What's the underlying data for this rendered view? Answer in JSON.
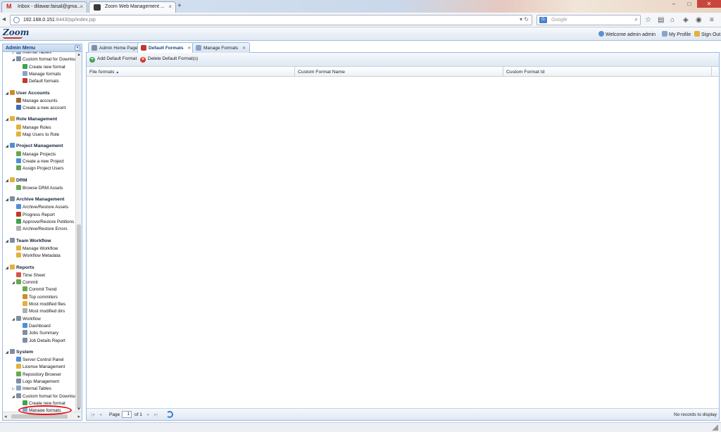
{
  "browser": {
    "tabs": [
      {
        "title": "Inbox - dilawar.faisal@gma...",
        "icon": "gmail-icon"
      },
      {
        "title": "Zoom Web Management ...",
        "icon": "zoom-page-icon"
      }
    ],
    "new_tab": "+",
    "address": {
      "host": "192.168.0.151",
      "rest": ":8443/jsp/index.jsp"
    },
    "search": {
      "engine": "G",
      "placeholder": "Google"
    },
    "window_buttons": {
      "minimize": "–",
      "maximize": "□",
      "close": "✕"
    }
  },
  "app": {
    "logo": "Zoom",
    "header_links": {
      "welcome": "Welcome admin admin",
      "profile": "My Profile",
      "signout": "Sign Out"
    }
  },
  "sidebar": {
    "title": "Admin Menu",
    "collapse": "«",
    "tree": [
      {
        "label": "Internal Tables",
        "level": 1,
        "icon": "table-icon",
        "color": "#8aa4c8"
      },
      {
        "label": "Custom format for Downloa",
        "level": 1,
        "icon": "format-icon",
        "color": "#7f8ea3",
        "expanded": true
      },
      {
        "label": "Create new format",
        "level": 2,
        "icon": "add-icon",
        "color": "#3fa34d"
      },
      {
        "label": "Manage formats",
        "level": 2,
        "icon": "list-icon",
        "color": "#8aa4c8"
      },
      {
        "label": "Default formats",
        "level": 2,
        "icon": "default-format-icon",
        "color": "#c0392b"
      },
      {
        "label": "User Accounts",
        "level": 0,
        "icon": "users-icon",
        "color": "#d18b2c",
        "group": true
      },
      {
        "label": "Manage accounts",
        "level": 1,
        "icon": "account-icon",
        "color": "#a0693a"
      },
      {
        "label": "Create a new account",
        "level": 1,
        "icon": "new-account-icon",
        "color": "#3b6fb5"
      },
      {
        "label": "Role Management",
        "level": 0,
        "icon": "role-icon",
        "color": "#e3b23c",
        "group": true
      },
      {
        "label": "Manage Roles",
        "level": 1,
        "icon": "roles-icon",
        "color": "#e3b23c"
      },
      {
        "label": "Map Users to Role",
        "level": 1,
        "icon": "map-icon",
        "color": "#e3b23c"
      },
      {
        "label": "Project Management",
        "level": 0,
        "icon": "project-icon",
        "color": "#4f8fd6",
        "group": true
      },
      {
        "label": "Manage Projects",
        "level": 1,
        "icon": "projects-icon",
        "color": "#6aa84f"
      },
      {
        "label": "Create a new Project",
        "level": 1,
        "icon": "new-project-icon",
        "color": "#4f8fd6"
      },
      {
        "label": "Assign Project Users",
        "level": 1,
        "icon": "assign-icon",
        "color": "#6aa84f"
      },
      {
        "label": "DRM",
        "level": 0,
        "icon": "drm-icon",
        "color": "#e3b23c",
        "group": true
      },
      {
        "label": "Browse DRM Assets",
        "level": 1,
        "icon": "drm-browse-icon",
        "color": "#6aa84f"
      },
      {
        "label": "Archive Management",
        "level": 0,
        "icon": "archive-icon",
        "color": "#7f8ea3",
        "group": true
      },
      {
        "label": "Archive/Restore Assets",
        "level": 1,
        "icon": "archive-restore-icon",
        "color": "#4f8fd6"
      },
      {
        "label": "Progress Report",
        "level": 1,
        "icon": "report-icon",
        "color": "#c0392b"
      },
      {
        "label": "Approve/Restore Petitions",
        "level": 1,
        "icon": "approve-icon",
        "color": "#3fa34d"
      },
      {
        "label": "Archive/Restore Errors",
        "level": 1,
        "icon": "error-icon",
        "color": "#b0b0b0"
      },
      {
        "label": "Team Workflow",
        "level": 0,
        "icon": "workflow-icon",
        "color": "#7f8ea3",
        "group": true
      },
      {
        "label": "Manage Workflow",
        "level": 1,
        "icon": "manage-workflow-icon",
        "color": "#e3b23c"
      },
      {
        "label": "Workflow Metadata",
        "level": 1,
        "icon": "metadata-icon",
        "color": "#e3b23c"
      },
      {
        "label": "Reports",
        "level": 0,
        "icon": "reports-icon",
        "color": "#e3b23c",
        "group": true
      },
      {
        "label": "Time Sheet",
        "level": 1,
        "icon": "timesheet-icon",
        "color": "#d9534f"
      },
      {
        "label": "Commit",
        "level": 1,
        "icon": "commit-icon",
        "color": "#6aa84f",
        "expanded": true
      },
      {
        "label": "Commit Trend",
        "level": 2,
        "icon": "trend-icon",
        "color": "#6aa84f"
      },
      {
        "label": "Top commiters",
        "level": 2,
        "icon": "commiters-icon",
        "color": "#d18b2c"
      },
      {
        "label": "Most modified files",
        "level": 2,
        "icon": "files-icon",
        "color": "#e3b23c"
      },
      {
        "label": "Most modified dirs",
        "level": 2,
        "icon": "dirs-icon",
        "color": "#b0b0b0"
      },
      {
        "label": "Workflow",
        "level": 1,
        "icon": "workflow-report-icon",
        "color": "#7f8ea3",
        "expanded": true
      },
      {
        "label": "Dashboard",
        "level": 2,
        "icon": "dashboard-icon",
        "color": "#4f8fd6"
      },
      {
        "label": "Jobs Summary",
        "level": 2,
        "icon": "jobs-icon",
        "color": "#7f8ea3"
      },
      {
        "label": "Job Details Report",
        "level": 2,
        "icon": "job-details-icon",
        "color": "#7f8ea3"
      },
      {
        "label": "System",
        "level": 0,
        "icon": "system-icon",
        "color": "#7f8ea3",
        "group": true
      },
      {
        "label": "Server Control Panel",
        "level": 1,
        "icon": "server-icon",
        "color": "#4f8fd6"
      },
      {
        "label": "License Management",
        "level": 1,
        "icon": "license-icon",
        "color": "#e3b23c"
      },
      {
        "label": "Repository Browser",
        "level": 1,
        "icon": "repository-icon",
        "color": "#6aa84f"
      },
      {
        "label": "Logs Management",
        "level": 1,
        "icon": "logs-icon",
        "color": "#7f8ea3"
      },
      {
        "label": "Internal Tables",
        "level": 1,
        "icon": "table-icon",
        "color": "#8aa4c8"
      },
      {
        "label": "Custom format for Downloa",
        "level": 1,
        "icon": "format-icon",
        "color": "#7f8ea3",
        "expanded": true
      },
      {
        "label": "Create new format",
        "level": 2,
        "icon": "add-icon",
        "color": "#3fa34d"
      },
      {
        "label": "Manage formats",
        "level": 2,
        "icon": "list-icon",
        "color": "#8aa4c8"
      },
      {
        "label": "Default formats",
        "level": 2,
        "icon": "default-format-icon",
        "color": "#c0392b",
        "selected": true
      }
    ]
  },
  "content": {
    "tabs": [
      {
        "label": "Admin Home Page",
        "icon": "home-icon",
        "color": "#7f8ea3",
        "closable": false
      },
      {
        "label": "Default Formats",
        "icon": "default-format-icon",
        "color": "#c0392b",
        "closable": true,
        "active": true
      },
      {
        "label": "Manage Formats",
        "icon": "list-icon",
        "color": "#8aa4c8",
        "closable": true
      }
    ],
    "close_glyph": "✕",
    "toolbar": {
      "add": "Add Default Format",
      "delete": "Delete Default Format(s)"
    },
    "grid": {
      "columns": [
        "File formats",
        "Custom Format Name",
        "Custom Format Id"
      ],
      "sort_indicator": "▲",
      "rows": []
    },
    "pager": {
      "page_label": "Page",
      "page_value": "1",
      "of_label": "of 1",
      "empty_text": "No records to display"
    }
  }
}
